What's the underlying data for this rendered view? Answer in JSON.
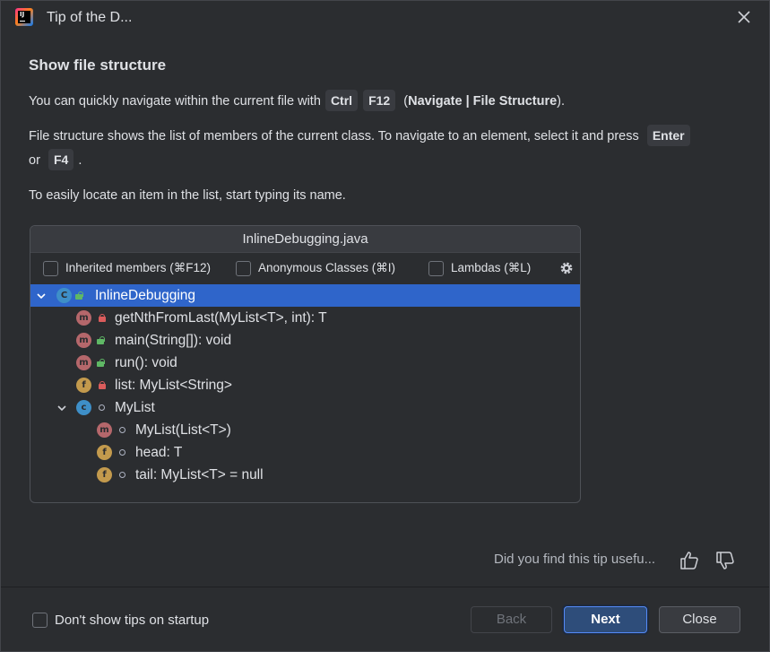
{
  "window": {
    "title": "Tip of the D..."
  },
  "tip": {
    "heading": "Show file structure",
    "p1_pre": "You can quickly navigate within the current file with ",
    "p1_key1": "Ctrl",
    "p1_key2": "F12",
    "p1_open": "(",
    "p1_action": "Navigate | File Structure",
    "p1_close": ").",
    "p2_pre": "File structure shows the list of members of the current class. To navigate to an element, select it and press ",
    "p2_key1": "Enter",
    "p2_or": "or ",
    "p2_key2": "F4",
    "p2_end": ".",
    "p3": "To easily locate an item in the list, start typing its name."
  },
  "panel": {
    "title": "InlineDebugging.java",
    "options": [
      {
        "label": "Inherited members (⌘F12)",
        "checked": false
      },
      {
        "label": "Anonymous Classes (⌘I)",
        "checked": false
      },
      {
        "label": "Lambdas (⌘L)",
        "checked": false
      }
    ],
    "tree": [
      {
        "label": "InlineDebugging",
        "icon": "class-icon",
        "selected": true
      },
      {
        "label": "getNthFromLast(MyList<T>, int): T",
        "icon": "method-icon",
        "access": "private"
      },
      {
        "label": "main(String[]): void",
        "icon": "method-icon",
        "access": "public"
      },
      {
        "label": "run(): void",
        "icon": "method-icon",
        "access": "public"
      },
      {
        "label": "list: MyList<String>",
        "icon": "field-icon",
        "access": "private"
      },
      {
        "label": "MyList",
        "icon": "class-icon",
        "access": "package"
      },
      {
        "label": "MyList(List<T>)",
        "icon": "method-icon",
        "access": "package"
      },
      {
        "label": "head: T",
        "icon": "field-icon",
        "access": "package"
      },
      {
        "label": "tail: MyList<T> = null",
        "icon": "field-icon",
        "access": "package"
      }
    ]
  },
  "feedback": {
    "question": "Did you find this tip usefu..."
  },
  "footer": {
    "dont_show": "Don't show tips on startup",
    "back": "Back",
    "next": "Next",
    "close": "Close"
  },
  "colors": {
    "background": "#2b2d30",
    "selection": "#2f65ca",
    "primary_button": "#2e4d7a"
  }
}
